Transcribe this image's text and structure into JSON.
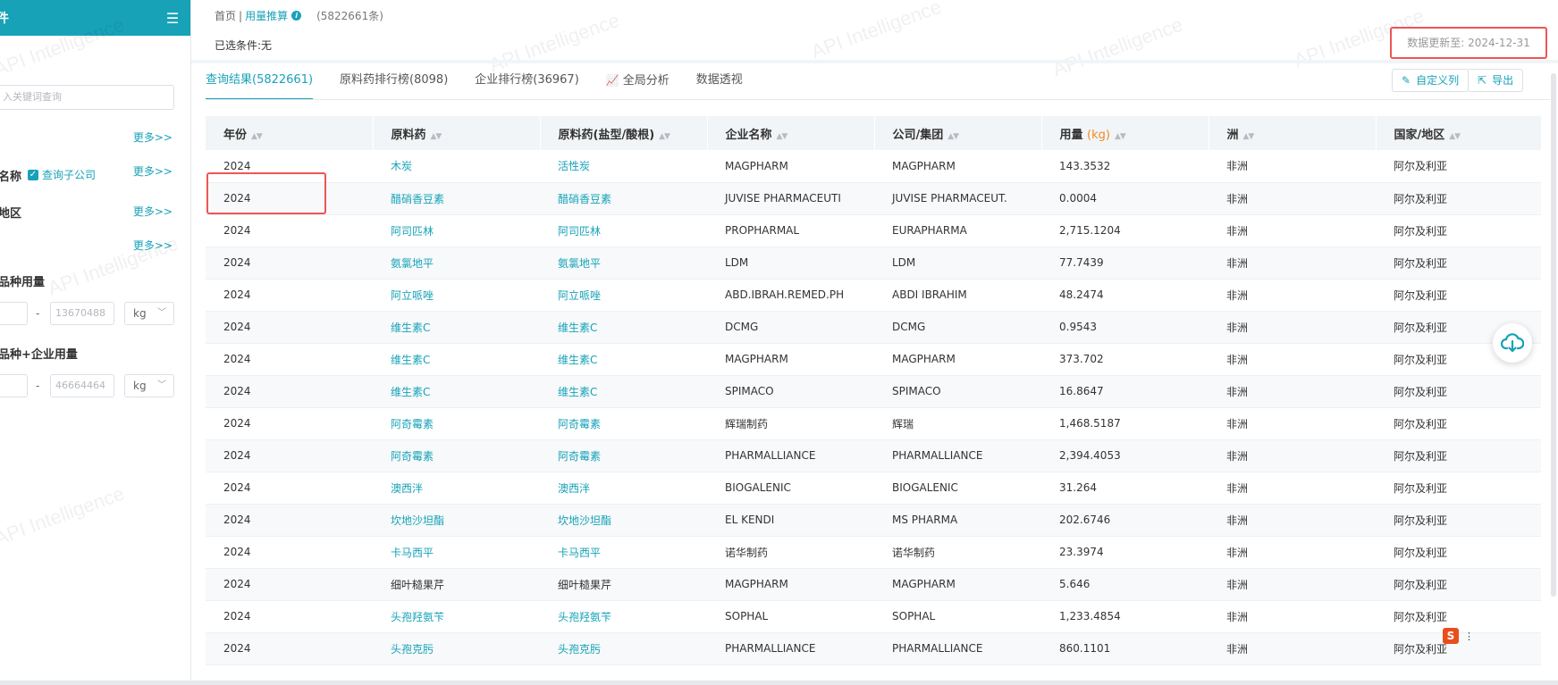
{
  "sidebar": {
    "title": "件",
    "menu_icon": "list-icon",
    "search_placeholder": "入关键词查询",
    "more_links": [
      "更多>>",
      "更多>>",
      "更多>>",
      "更多>>"
    ],
    "labels": {
      "company_name": "名称",
      "region": "地区",
      "variety_usage": "品种用量",
      "variety_company_usage": "品种+企业用量"
    },
    "checkbox_subsidiary": "查询子公司",
    "range1": {
      "min": "",
      "max": "13670488",
      "unit": "kg"
    },
    "range2": {
      "min": "",
      "max": "46664464",
      "unit": "kg"
    }
  },
  "header": {
    "breadcrumb_home": "首页",
    "breadcrumb_sep": "|",
    "breadcrumb_current": "用量推算",
    "record_count": "(5822661条)",
    "selected_conditions": "已选条件:无",
    "update_label": "数据更新至:",
    "update_date": "2024-12-31"
  },
  "tabs": [
    {
      "label": "查询结果(5822661)"
    },
    {
      "label": "原料药排行榜(8098)"
    },
    {
      "label": "企业排行榜(36967)"
    },
    {
      "label": "全局分析"
    },
    {
      "label": "数据透视"
    }
  ],
  "toolbar": {
    "custom_columns": "自定义列",
    "export": "导出"
  },
  "watermark_text": "API Intelligence",
  "table": {
    "columns": [
      {
        "label": "年份",
        "unit": ""
      },
      {
        "label": "原料药",
        "unit": ""
      },
      {
        "label": "原料药(盐型/酸根)",
        "unit": ""
      },
      {
        "label": "企业名称",
        "unit": ""
      },
      {
        "label": "公司/集团",
        "unit": ""
      },
      {
        "label": "用量",
        "unit": "(kg)"
      },
      {
        "label": "洲",
        "unit": ""
      },
      {
        "label": "国家/地区",
        "unit": ""
      }
    ],
    "rows": [
      [
        "2024",
        "木炭",
        "活性炭",
        "MAGPHARM",
        "MAGPHARM",
        "143.3532",
        "非洲",
        "阿尔及利亚"
      ],
      [
        "2024",
        "醋硝香豆素",
        "醋硝香豆素",
        "JUVISE PHARMACEUTI",
        "JUVISE PHARMACEUT.",
        "0.0004",
        "非洲",
        "阿尔及利亚"
      ],
      [
        "2024",
        "阿司匹林",
        "阿司匹林",
        "PROPHARMAL",
        "EURAPHARMA",
        "2,715.1204",
        "非洲",
        "阿尔及利亚"
      ],
      [
        "2024",
        "氨氯地平",
        "氨氯地平",
        "LDM",
        "LDM",
        "77.7439",
        "非洲",
        "阿尔及利亚"
      ],
      [
        "2024",
        "阿立哌唑",
        "阿立哌唑",
        "ABD.IBRAH.REMED.PH",
        "ABDI IBRAHIM",
        "48.2474",
        "非洲",
        "阿尔及利亚"
      ],
      [
        "2024",
        "维生素C",
        "维生素C",
        "DCMG",
        "DCMG",
        "0.9543",
        "非洲",
        "阿尔及利亚"
      ],
      [
        "2024",
        "维生素C",
        "维生素C",
        "MAGPHARM",
        "MAGPHARM",
        "373.702",
        "非洲",
        "阿尔及利亚"
      ],
      [
        "2024",
        "维生素C",
        "维生素C",
        "SPIMACO",
        "SPIMACO",
        "16.8647",
        "非洲",
        "阿尔及利亚"
      ],
      [
        "2024",
        "阿奇霉素",
        "阿奇霉素",
        "辉瑞制药",
        "辉瑞",
        "1,468.5187",
        "非洲",
        "阿尔及利亚"
      ],
      [
        "2024",
        "阿奇霉素",
        "阿奇霉素",
        "PHARMALLIANCE",
        "PHARMALLIANCE",
        "2,394.4053",
        "非洲",
        "阿尔及利亚"
      ],
      [
        "2024",
        "澳西泮",
        "澳西泮",
        "BIOGALENIC",
        "BIOGALENIC",
        "31.264",
        "非洲",
        "阿尔及利亚"
      ],
      [
        "2024",
        "坎地沙坦酯",
        "坎地沙坦酯",
        "EL KENDI",
        "MS PHARMA",
        "202.6746",
        "非洲",
        "阿尔及利亚"
      ],
      [
        "2024",
        "卡马西平",
        "卡马西平",
        "诺华制药",
        "诺华制药",
        "23.3974",
        "非洲",
        "阿尔及利亚"
      ],
      [
        "2024",
        "细叶糙果芹",
        "细叶糙果芹",
        "MAGPHARM",
        "MAGPHARM",
        "5.646",
        "非洲",
        "阿尔及利亚"
      ],
      [
        "2024",
        "头孢羟氨苄",
        "头孢羟氨苄",
        "SOPHAL",
        "SOPHAL",
        "1,233.4854",
        "非洲",
        "阿尔及利亚"
      ],
      [
        "2024",
        "头孢克肟",
        "头孢克肟",
        "PHARMALLIANCE",
        "PHARMALLIANCE",
        "860.1101",
        "非洲",
        "阿尔及利亚"
      ]
    ],
    "link_columns": [
      1,
      2
    ],
    "plain_link_exceptions": [
      "细叶糙果芹"
    ]
  },
  "colors": {
    "accent": "#17a2b8",
    "highlight_border": "#e55555",
    "unit_orange": "#f08a24"
  },
  "sogou_label": "S"
}
